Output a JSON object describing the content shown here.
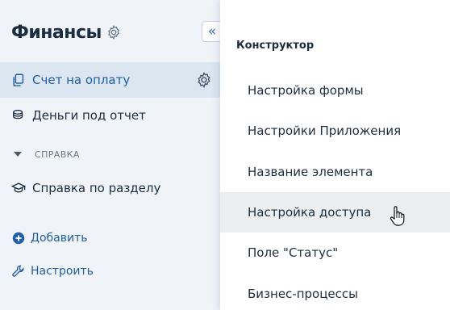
{
  "sidebar": {
    "title": "Финансы",
    "items": [
      {
        "label": "Счет на оплату",
        "icon": "copy-icon",
        "active": true
      },
      {
        "label": "Деньги под отчет",
        "icon": "coins-icon",
        "active": false
      }
    ],
    "section": {
      "label": "СПРАВКА",
      "items": [
        {
          "label": "Справка по разделу",
          "icon": "graduation-cap-icon"
        }
      ]
    },
    "actions": [
      {
        "label": "Добавить",
        "icon": "plus-circle-icon"
      },
      {
        "label": "Настроить",
        "icon": "wrench-icon"
      }
    ],
    "collapse_glyph": "«"
  },
  "menu": {
    "heading": "Конструктор",
    "items": [
      {
        "label": "Настройка формы"
      },
      {
        "label": "Настройки Приложения"
      },
      {
        "label": "Название элемента"
      },
      {
        "label": "Настройка доступа",
        "hovered": true
      },
      {
        "label": "Поле \"Статус\""
      },
      {
        "label": "Бизнес-процессы"
      }
    ]
  },
  "colors": {
    "sidebar_bg": "#f0f4f9",
    "active_bg": "#dce6f1",
    "accent": "#1f5ea6",
    "text": "#1c2d40",
    "hover_bg": "#eceeef"
  }
}
